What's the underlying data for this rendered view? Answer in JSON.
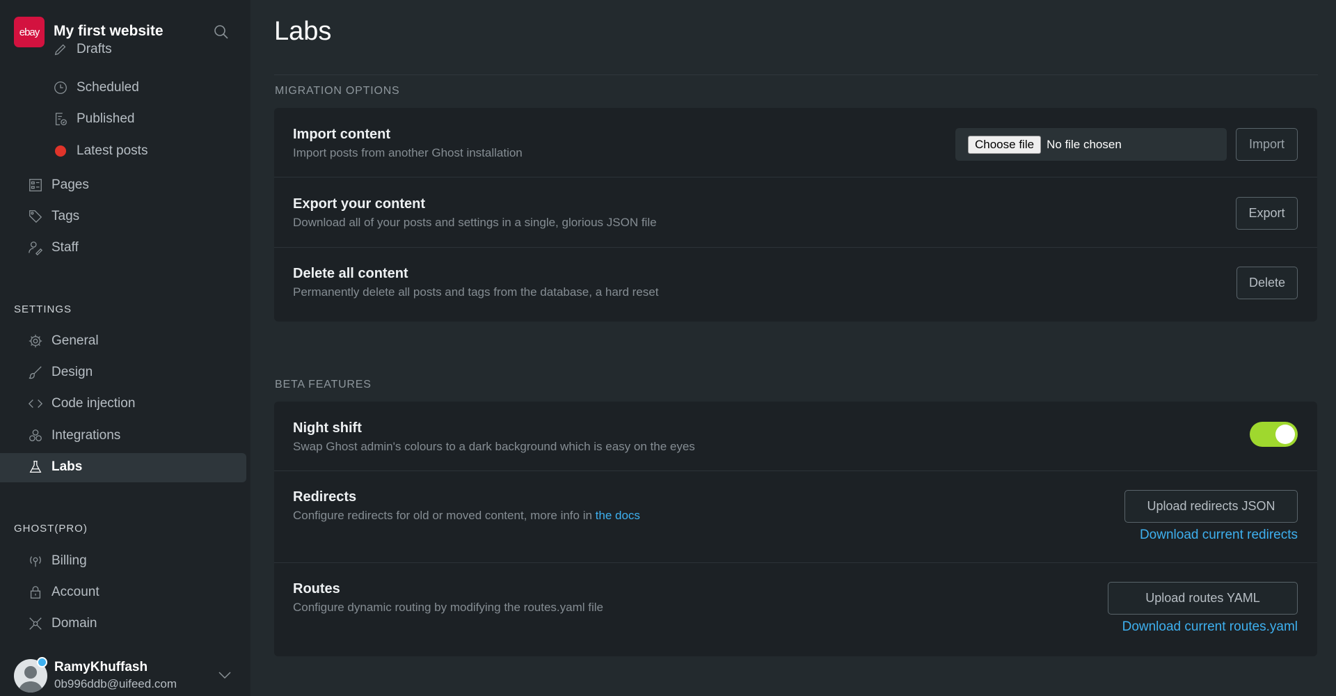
{
  "sidebar": {
    "logo_text": "ebay",
    "site_title": "My first website",
    "posts_sub": [
      "Drafts",
      "Scheduled",
      "Published",
      "Latest posts"
    ],
    "main_items": [
      "Pages",
      "Tags",
      "Staff"
    ],
    "settings_label": "SETTINGS",
    "settings_items": [
      "General",
      "Design",
      "Code injection",
      "Integrations",
      "Labs"
    ],
    "ghost_label": "GHOST(PRO)",
    "ghost_items": [
      "Billing",
      "Account",
      "Domain"
    ],
    "user": {
      "name": "RamyKhuffash",
      "email": "0b996ddb@uifeed.com"
    }
  },
  "main": {
    "title": "Labs",
    "migration": {
      "label": "MIGRATION OPTIONS",
      "import": {
        "title": "Import content",
        "desc": "Import posts from another Ghost installation",
        "choose": "Choose file",
        "no_file": "No file chosen",
        "button": "Import"
      },
      "export": {
        "title": "Export your content",
        "desc": "Download all of your posts and settings in a single, glorious JSON file",
        "button": "Export"
      },
      "delete": {
        "title": "Delete all content",
        "desc": "Permanently delete all posts and tags from the database, a hard reset",
        "button": "Delete"
      }
    },
    "beta": {
      "label": "BETA FEATURES",
      "night": {
        "title": "Night shift",
        "desc": "Swap Ghost admin's colours to a dark background which is easy on the eyes",
        "enabled": true
      },
      "redirects": {
        "title": "Redirects",
        "desc": "Configure redirects for old or moved content, more info in ",
        "link": "the docs",
        "button": "Upload redirects JSON",
        "download": "Download current redirects"
      },
      "routes": {
        "title": "Routes",
        "desc": "Configure dynamic routing by modifying the routes.yaml file",
        "button": "Upload routes YAML",
        "download": "Download current routes.yaml"
      }
    }
  },
  "colors": {
    "accent": "#3eb0ef",
    "toggle_on": "#9fd82e",
    "brand": "#d3123f"
  }
}
